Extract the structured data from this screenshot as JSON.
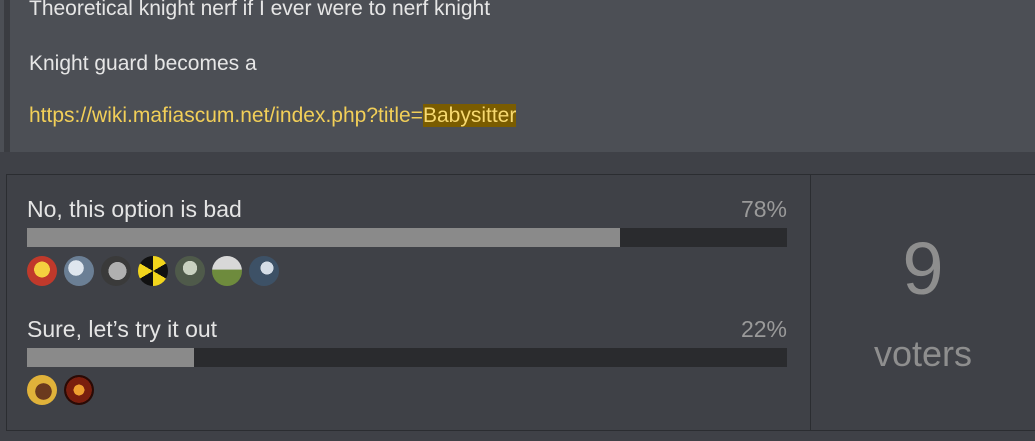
{
  "post": {
    "line1": "Theoretical knight nerf if I ever were to nerf knight",
    "line2": "Knight guard becomes a",
    "link_prefix": "https://wiki.mafiascum.net/index.php?title=",
    "link_highlight": "Babysitter"
  },
  "poll": {
    "options": [
      {
        "label": "No, this option is bad",
        "percent_text": "78%",
        "percent": 78,
        "avatars": [
          "avatar-red-yellow",
          "avatar-scribble",
          "avatar-gray-animal",
          "avatar-radiation",
          "avatar-robot",
          "avatar-pixel",
          "avatar-figure"
        ]
      },
      {
        "label": "Sure, let’s try it out",
        "percent_text": "22%",
        "percent": 22,
        "avatars": [
          "avatar-cartoon",
          "avatar-fire"
        ]
      }
    ],
    "voters_count": "9",
    "voters_label": "voters"
  }
}
